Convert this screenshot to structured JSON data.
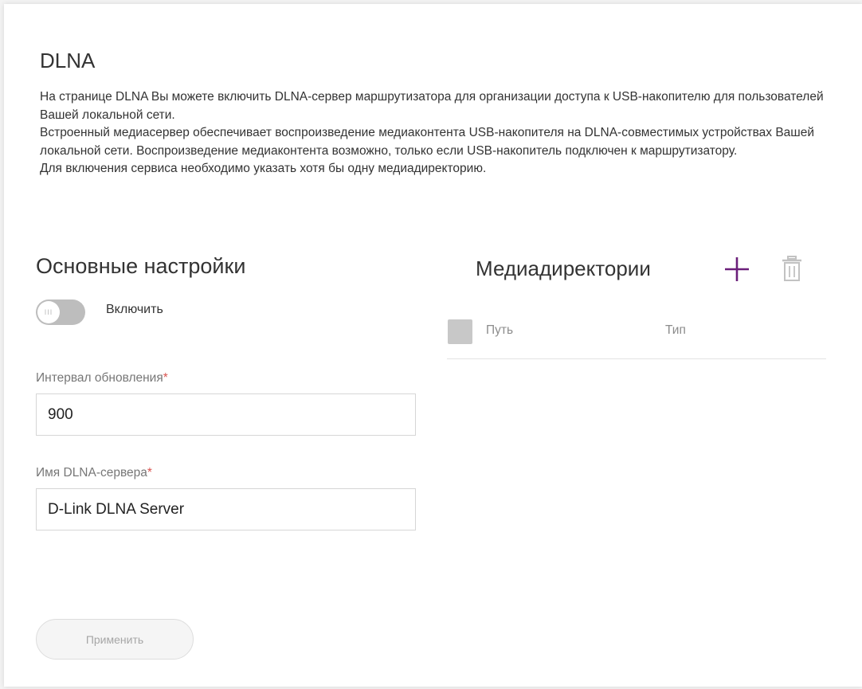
{
  "page": {
    "title": "DLNA",
    "description": [
      "На странице DLNA Вы можете включить DLNA-сервер маршрутизатора для организации доступа к USB-накопителю для пользователей Вашей локальной сети.",
      "Встроенный медиасервер обеспечивает воспроизведение медиаконтента USB-накопителя на DLNA-совместимых устройствах Вашей локальной сети. Воспроизведение медиаконтента возможно, только если USB-накопитель подключен к маршрутизатору.",
      "Для включения сервиса необходимо указать хотя бы одну медиадиректорию."
    ]
  },
  "basic_settings": {
    "title": "Основные настройки",
    "enable_toggle": {
      "label": "Включить",
      "checked": false,
      "knob_glyph": "III"
    },
    "update_interval": {
      "label": "Интервал обновления",
      "required_mark": "*",
      "value": "900"
    },
    "server_name": {
      "label": "Имя DLNA-сервера",
      "required_mark": "*",
      "value": "D-Link DLNA Server"
    },
    "apply_label": "Применить"
  },
  "media_dirs": {
    "title": "Медиадиректории",
    "add_icon": "plus-icon",
    "delete_icon": "trash-icon",
    "columns": [
      "Путь",
      "Тип"
    ],
    "rows": []
  },
  "colors": {
    "accent": "#6b1f7a",
    "required": "#d9534f",
    "toggle_off": "#bdbdbd",
    "disabled_text": "#a6a6a6"
  }
}
